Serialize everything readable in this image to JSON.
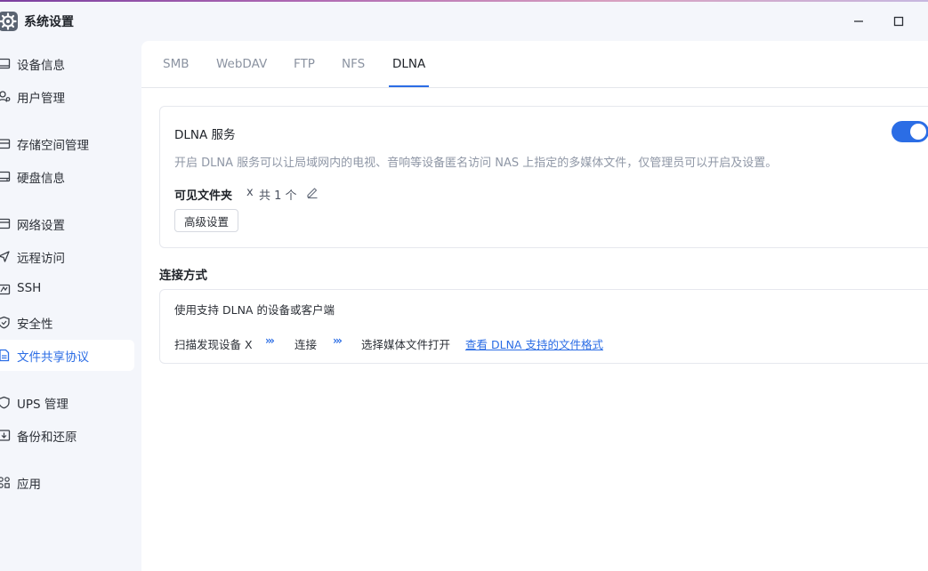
{
  "window": {
    "title": "系统设置",
    "minimize_icon": "minimize-icon",
    "maximize_icon": "maximize-icon"
  },
  "sidebar": {
    "items": [
      {
        "label": "设备信息",
        "icon": "device-icon"
      },
      {
        "label": "用户管理",
        "icon": "user-icon"
      },
      {
        "label": "存储空间管理",
        "icon": "storage-icon"
      },
      {
        "label": "硬盘信息",
        "icon": "disk-icon"
      },
      {
        "label": "网络设置",
        "icon": "network-icon"
      },
      {
        "label": "远程访问",
        "icon": "remote-icon"
      },
      {
        "label": "SSH",
        "icon": "ssh-icon"
      },
      {
        "label": "安全性",
        "icon": "shield-icon"
      },
      {
        "label": "文件共享协议",
        "icon": "file-share-icon",
        "active": true
      },
      {
        "label": "UPS 管理",
        "icon": "ups-icon"
      },
      {
        "label": "备份和还原",
        "icon": "backup-icon"
      },
      {
        "label": "应用",
        "icon": "apps-icon"
      }
    ]
  },
  "tabs": [
    {
      "label": "SMB"
    },
    {
      "label": "WebDAV"
    },
    {
      "label": "FTP"
    },
    {
      "label": "NFS"
    },
    {
      "label": "DLNA",
      "active": true
    }
  ],
  "dlna": {
    "title": "DLNA 服务",
    "enabled": true,
    "description": "开启 DLNA 服务可以让局域网内的电视、音响等设备匿名访问 NAS 上指定的多媒体文件，仅管理员可以开启及设置。",
    "visible_folders_label": "可见文件夹",
    "visible_folders_x": "x",
    "visible_folders_count": "共 1 个",
    "advanced_button": "高级设置"
  },
  "connection": {
    "section_title": "连接方式",
    "card_title": "使用支持 DLNA 的设备或客户端",
    "steps": [
      "扫描发现设备 X",
      "连接",
      "选择媒体文件打开"
    ],
    "arrow": "›››",
    "link": "查看 DLNA 支持的文件格式"
  },
  "colors": {
    "accent": "#2b6de5",
    "sidebar_bg": "#f4f6fb",
    "panel_bg": "#ffffff"
  }
}
